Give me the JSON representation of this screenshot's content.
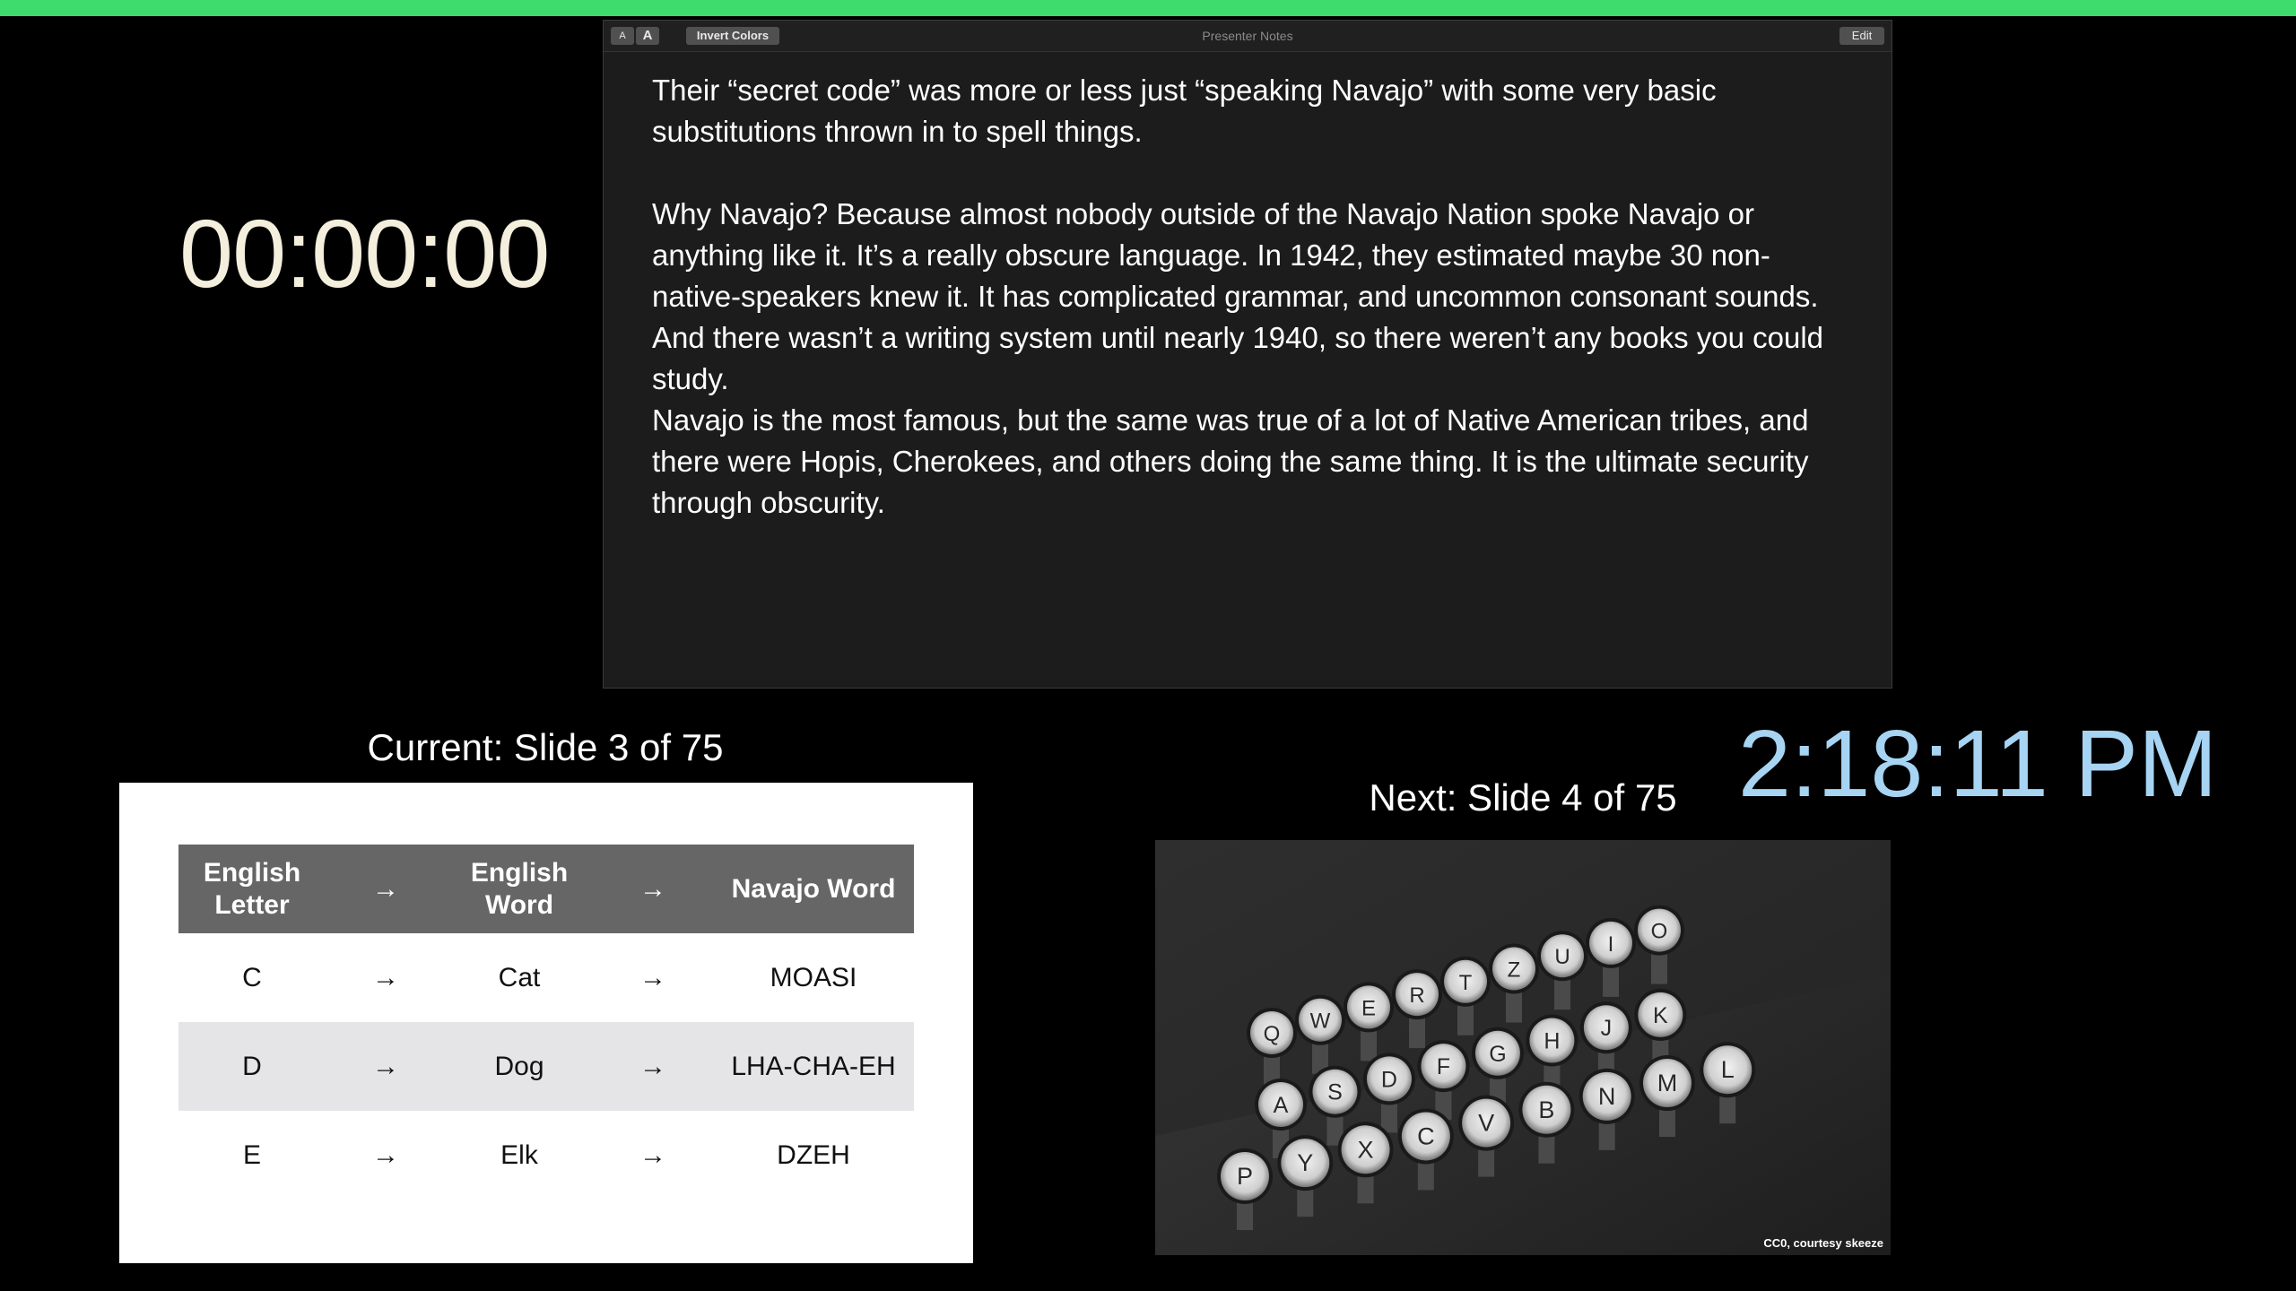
{
  "timer": {
    "elapsed": "00:00:00"
  },
  "clock": {
    "time": "2:18:11 PM"
  },
  "notes": {
    "toolbar": {
      "font_small": "A",
      "font_large": "A",
      "invert": "Invert Colors",
      "title": "Presenter Notes",
      "edit": "Edit"
    },
    "paragraphs": [
      "Their “secret code” was more or less just “speaking Navajo” with some very basic substitutions thrown in to spell things.",
      "Why Navajo? Because almost nobody outside of the Navajo Nation spoke Navajo or anything like it. It’s a really obscure language. In 1942, they estimated maybe 30 non-native-speakers knew it. It has complicated grammar, and uncommon consonant sounds. And there wasn’t a writing system until nearly 1940, so there weren’t any books you could study.",
      "Navajo is the most famous, but the same was true of a lot of Native American tribes, and there were Hopis, Cherokees, and others doing the same thing. It is the ultimate security through obscurity."
    ]
  },
  "current": {
    "label": "Current: Slide 3 of 75",
    "table": {
      "headers": [
        "English Letter",
        "→",
        "English Word",
        "→",
        "Navajo Word"
      ],
      "rows": [
        [
          "C",
          "→",
          "Cat",
          "→",
          "MOASI"
        ],
        [
          "D",
          "→",
          "Dog",
          "→",
          "LHA-CHA-EH"
        ],
        [
          "E",
          "→",
          "Elk",
          "→",
          "DZEH"
        ]
      ]
    }
  },
  "next": {
    "label": "Next: Slide 4 of 75",
    "credit": "CC0, courtesy skeeze",
    "key_letters": [
      "Q",
      "W",
      "E",
      "R",
      "T",
      "Z",
      "U",
      "I",
      "O",
      "A",
      "S",
      "D",
      "F",
      "G",
      "H",
      "J",
      "K",
      "P",
      "Y",
      "X",
      "C",
      "V",
      "B",
      "N",
      "M",
      "L"
    ]
  },
  "colors": {
    "top_bar": "#3ddc6c",
    "timer": "#f4eedd",
    "clock": "#a6d4f2",
    "table_header": "#666666",
    "table_shaded_row": "#e5e5e8"
  }
}
